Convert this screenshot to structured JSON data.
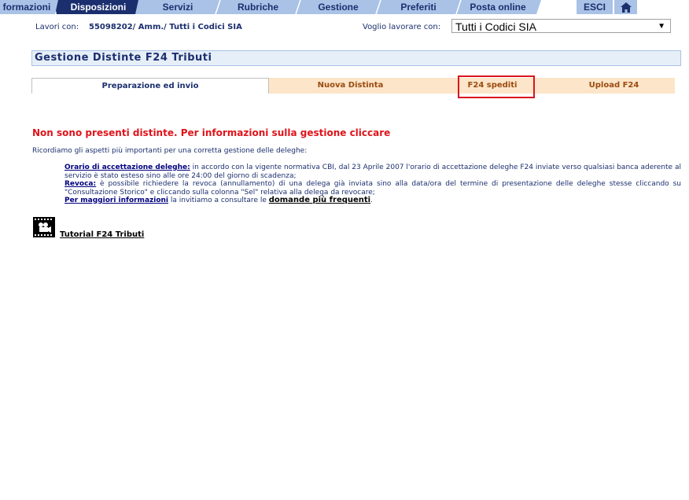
{
  "nav": {
    "tabs": [
      {
        "label": "formazioni",
        "active": false
      },
      {
        "label": "Disposizioni",
        "active": true
      },
      {
        "label": "Servizi",
        "active": false
      },
      {
        "label": "Rubriche",
        "active": false
      },
      {
        "label": "Gestione",
        "active": false
      },
      {
        "label": "Preferiti",
        "active": false
      },
      {
        "label": "Posta online",
        "active": false
      },
      {
        "label": "ESCI",
        "active": false
      }
    ],
    "home_icon": "home-icon"
  },
  "workline": {
    "label": "Lavori con:",
    "value": "55098202/ Amm./ Tutti i Codici SIA",
    "select_label": "Voglio lavorare con:",
    "select_value": "Tutti i Codici SIA"
  },
  "section": {
    "title": "Gestione Distinte F24 Tributi"
  },
  "subtabs": [
    {
      "label": "Preparazione ed invio",
      "active": true
    },
    {
      "label": "Nuova Distinta",
      "active": false
    },
    {
      "label": "F24 spediti",
      "active": false
    },
    {
      "label": "Upload F24",
      "active": false
    }
  ],
  "message": {
    "no_distinte": "Non sono presenti distinte. Per informazioni sulla gestione cliccare",
    "intro": "Ricordiamo gli aspetti più importanti per una corretta gestione delle deleghe:"
  },
  "notes": {
    "orario_link": "Orario di accettazione deleghe:",
    "orario_text": " in accordo con la vigente normativa CBI, dal 23 Aprile 2007 l'orario di accettazione deleghe F24 inviate verso qualsiasi banca aderente al servizio è stato esteso sino alle ore 24:00 del giorno di scadenza;",
    "revoca_link": "Revoca:",
    "revoca_text": " è possibile richiedere la revoca (annullamento) di una delega già inviata sino alla data/ora del termine di presentazione delle deleghe stesse cliccando su \"Consultazione Storico\" e cliccando sulla colonna \"Sel\" relativa alla delega da revocare;",
    "info_link": "Per maggiori informazioni",
    "info_text": " la invitiamo a consultare le ",
    "faq_link": "domande più frequenti",
    "faq_end": "."
  },
  "tutorial": {
    "label": "Tutorial F24 Tributi",
    "icon": "video-camera-icon"
  },
  "colors": {
    "nav_bg": "#a9c2e6",
    "nav_active": "#1b2f6e",
    "error_red": "#e0141b",
    "subtab_inactive": "#fce5c8"
  }
}
